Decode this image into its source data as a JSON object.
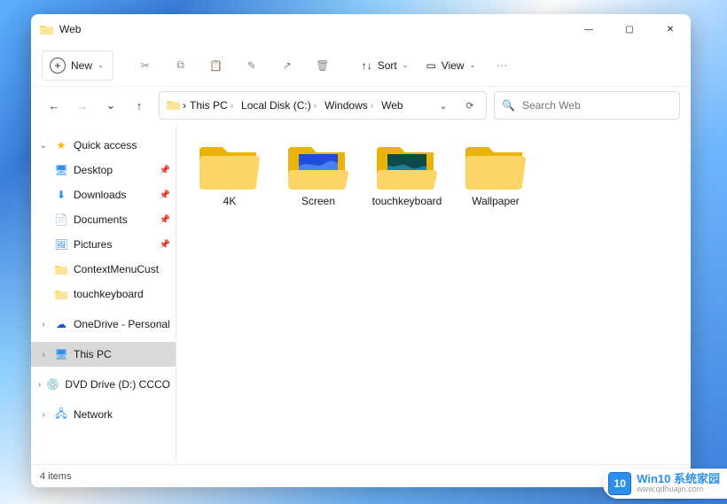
{
  "window": {
    "title": "Web"
  },
  "titlebar_controls": {
    "min_glyph": "—",
    "max_glyph": "▢",
    "close_glyph": "✕"
  },
  "toolbar": {
    "new_label": "New",
    "cut_glyph": "✂",
    "copy_glyph": "⧉",
    "paste_glyph": "📋",
    "rename_glyph": "✎",
    "share_glyph": "↗",
    "delete_glyph": "🗑",
    "sort_label": "Sort",
    "sort_glyph": "↑↓",
    "view_label": "View",
    "view_glyph": "▭",
    "more_glyph": "⋯"
  },
  "nav": {
    "back_glyph": "←",
    "forward_glyph": "→",
    "recent_glyph": "⌄",
    "up_glyph": "↑"
  },
  "breadcrumbs": [
    "This PC",
    "Local Disk (C:)",
    "Windows",
    "Web"
  ],
  "addrbar": {
    "dropdown_glyph": "⌄",
    "refresh_glyph": "⟳"
  },
  "search": {
    "placeholder": "Search Web",
    "glyph": "🔍"
  },
  "sidebar": {
    "quick_access": "Quick access",
    "items": [
      {
        "label": "Desktop",
        "pinned": true
      },
      {
        "label": "Downloads",
        "pinned": true
      },
      {
        "label": "Documents",
        "pinned": true
      },
      {
        "label": "Pictures",
        "pinned": true
      },
      {
        "label": "ContextMenuCust",
        "pinned": false
      },
      {
        "label": "touchkeyboard",
        "pinned": false
      }
    ],
    "onedrive": "OneDrive - Personal",
    "thispc": "This PC",
    "dvd": "DVD Drive (D:) CCCO",
    "network": "Network"
  },
  "folders": [
    {
      "name": "4K",
      "thumb": "none"
    },
    {
      "name": "Screen",
      "thumb": "blue"
    },
    {
      "name": "touchkeyboard",
      "thumb": "teal"
    },
    {
      "name": "Wallpaper",
      "thumb": "none"
    }
  ],
  "status": {
    "count_label": "4 items"
  },
  "watermark": {
    "badge": "10",
    "main": "Win10 系统家园",
    "sub": "www.qdhuajin.com"
  }
}
